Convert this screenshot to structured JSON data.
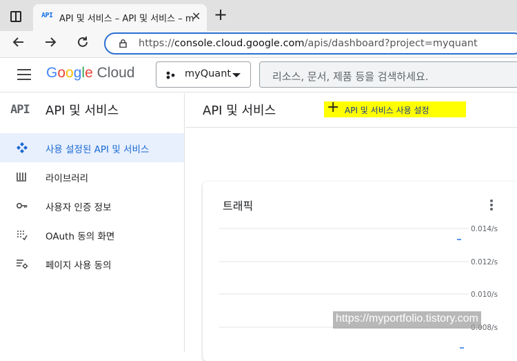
{
  "browser": {
    "tab": {
      "favicon": "API",
      "title": "API 및 서비스 – API 및 서비스 – myQuant",
      "close_icon": "close-icon"
    },
    "new_tab_label": "+",
    "address": {
      "scheme": "https://",
      "host": "console.cloud.google.com",
      "path": "/apis/dashboard?project=myquant"
    }
  },
  "header": {
    "logo_google": "Google",
    "logo_cloud": "Cloud",
    "project": "myQuant",
    "search_placeholder": "리소스, 문서, 제품 등을 검색하세요."
  },
  "sidebar": {
    "icon_text": "API",
    "title": "API 및 서비스",
    "items": [
      {
        "label": "사용 설정된 API 및 서비스",
        "icon": "dashboard-icon",
        "active": true
      },
      {
        "label": "라이브러리",
        "icon": "library-icon",
        "active": false
      },
      {
        "label": "사용자 인증 정보",
        "icon": "key-icon",
        "active": false
      },
      {
        "label": "OAuth 동의 화면",
        "icon": "oauth-dots-icon",
        "active": false
      },
      {
        "label": "페이지 사용 동의",
        "icon": "page-settings-icon",
        "active": false
      }
    ]
  },
  "main": {
    "title": "API 및 서비스",
    "enable_button": "API 및 서비스 사용 설정",
    "highlight_color": "#ffff00"
  },
  "traffic_card": {
    "title": "트래픽",
    "y_ticks": [
      "0.014/s",
      "0.012/s",
      "0.010/s",
      "0.008/s"
    ]
  },
  "watermark": "https://myportfolio.tistory.com",
  "colors": {
    "accent": "#1a73e8",
    "active_bg": "#e8f0fe",
    "active_text": "#1967d2"
  }
}
